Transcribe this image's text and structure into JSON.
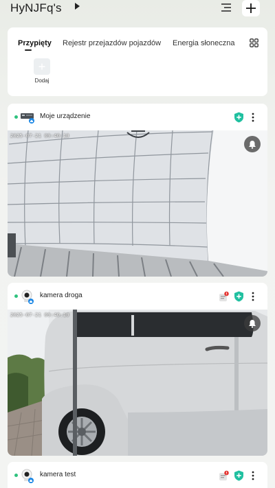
{
  "header": {
    "home_name": "HyNJFq's",
    "caret_icon": "caret-right-icon",
    "list_icon": "list-icon",
    "add_icon": "plus-icon"
  },
  "tabs": {
    "items": [
      {
        "label": "Przypięty",
        "active": true
      },
      {
        "label": "Rejestr przejazdów pojazdów",
        "active": false
      },
      {
        "label": "Energia słoneczna",
        "active": false
      }
    ],
    "grid_icon": "grid-icon"
  },
  "shortcut": {
    "add_label": "Dodaj",
    "add_icon": "plus-icon"
  },
  "devices": [
    {
      "name": "Moje urządzenie",
      "timestamp": "2025-07-21 09:40:10",
      "status_color": "#2ec27e",
      "has_alert": false
    },
    {
      "name": "kamera droga",
      "timestamp": "2025-07-21 09:40:10",
      "status_color": "#2ec27e",
      "has_alert": true
    },
    {
      "name": "kamera test",
      "status_color": "#2ec27e",
      "has_alert": true
    }
  ],
  "colors": {
    "accent_green": "#2ec27e",
    "shield_teal": "#20c0a0",
    "alert_red": "#e53935"
  }
}
